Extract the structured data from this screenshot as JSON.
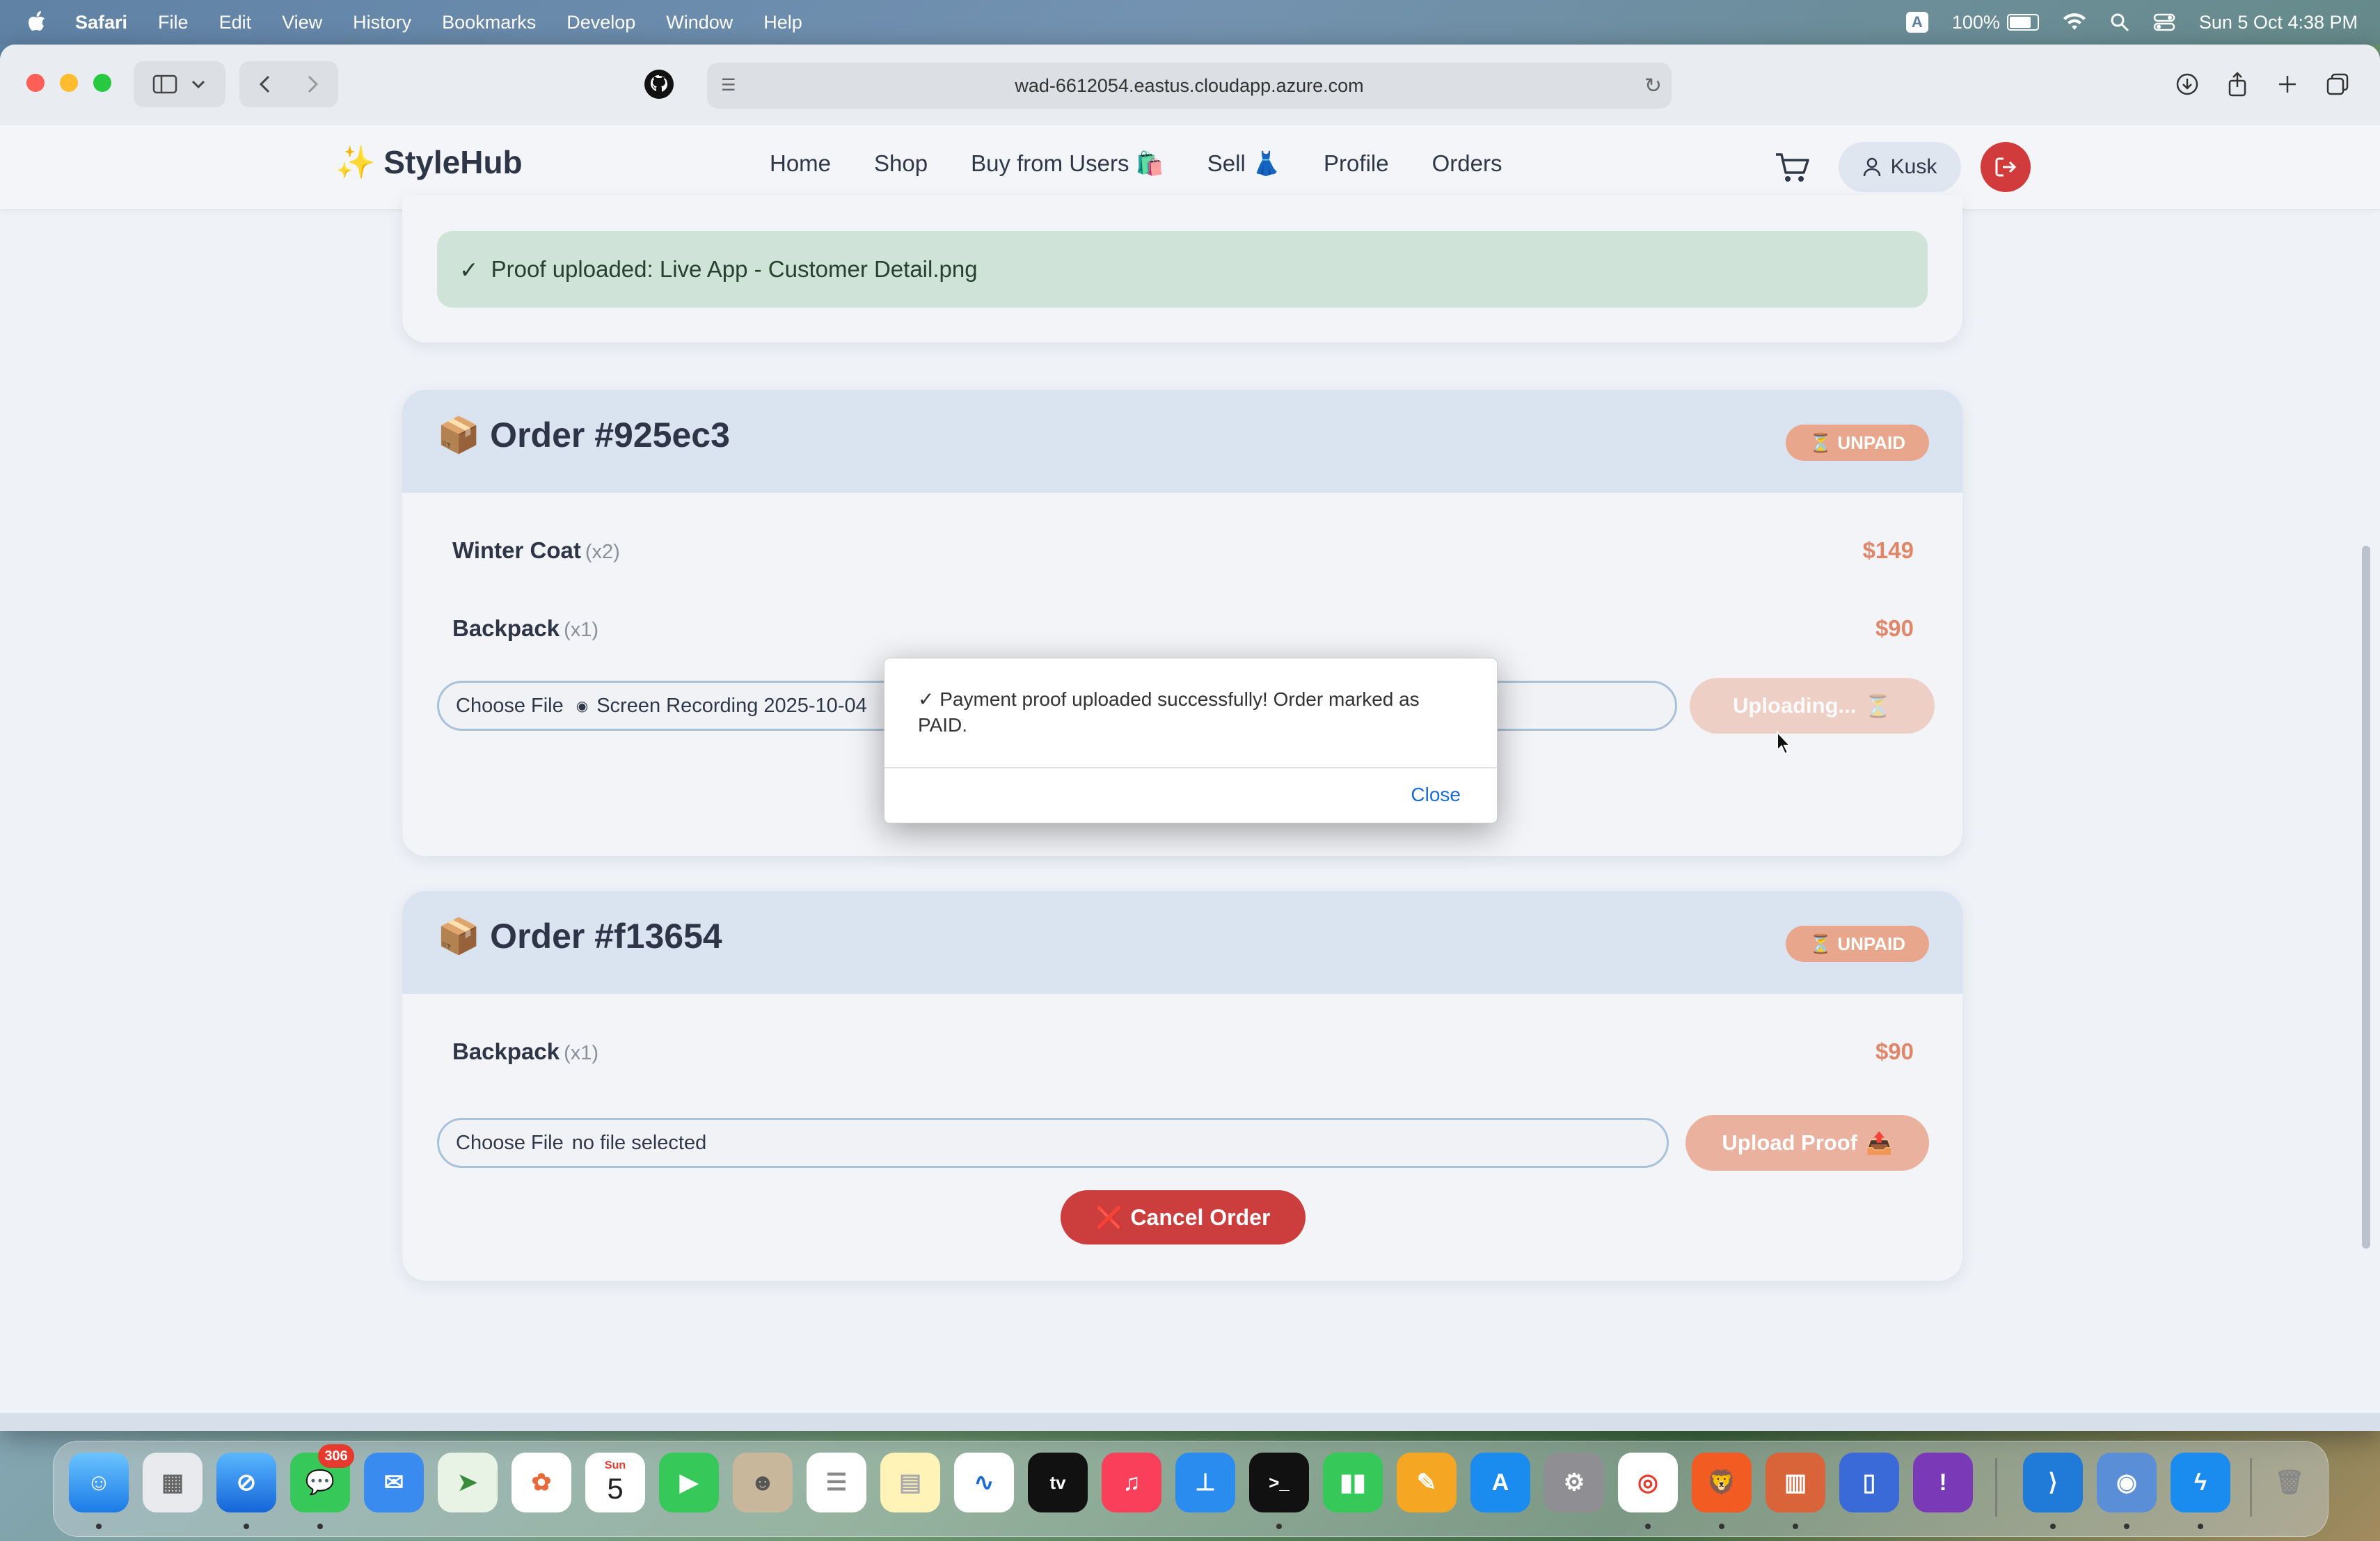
{
  "menubar": {
    "app": "Safari",
    "items": [
      "File",
      "Edit",
      "View",
      "History",
      "Bookmarks",
      "Develop",
      "Window",
      "Help"
    ],
    "input_badge": "A",
    "battery": "100%",
    "clock": "Sun 5 Oct  4:38 PM"
  },
  "browser": {
    "url": "wad-6612054.eastus.cloudapp.azure.com"
  },
  "site": {
    "brand_icon": "✨",
    "brand": "StyleHub",
    "nav": [
      "Home",
      "Shop",
      "Buy from Users 🛍️",
      "Sell 👗",
      "Profile",
      "Orders"
    ],
    "user": "Kusk"
  },
  "banner": {
    "check": "✓",
    "text": "Proof uploaded: Live App - Customer Detail.png"
  },
  "orders": [
    {
      "title": "Order #925ec3",
      "box_icon": "📦",
      "status": "UNPAID",
      "status_icon": "⏳",
      "items": [
        {
          "name": "Winter Coat",
          "qty": "(x2)",
          "price": "$149"
        },
        {
          "name": "Backpack",
          "qty": "(x1)",
          "price": "$90"
        }
      ],
      "file_label": "Choose File",
      "file_value": "Screen Recording 2025-10-04",
      "upload_label": "Uploading...",
      "upload_icon": "⏳"
    },
    {
      "title": "Order #f13654",
      "box_icon": "📦",
      "status": "UNPAID",
      "status_icon": "⏳",
      "items": [
        {
          "name": "Backpack",
          "qty": "(x1)",
          "price": "$90"
        }
      ],
      "file_label": "Choose File",
      "file_value": "no file selected",
      "upload_label": "Upload Proof",
      "upload_icon": "📤",
      "cancel_icon": "❌",
      "cancel_label": "Cancel Order"
    }
  ],
  "dialog": {
    "message": "✓ Payment proof uploaded successfully! Order marked as PAID.",
    "close": "Close"
  },
  "dock": {
    "messages_badge": "306",
    "calendar_day": "Sun",
    "calendar_date": "5"
  },
  "colors": {
    "accent": "#d23b3b",
    "unpaid_badge": "#e8a68d",
    "price": "#e0876a",
    "success_bg": "#cfe3d8",
    "link": "#1a6bd8"
  }
}
